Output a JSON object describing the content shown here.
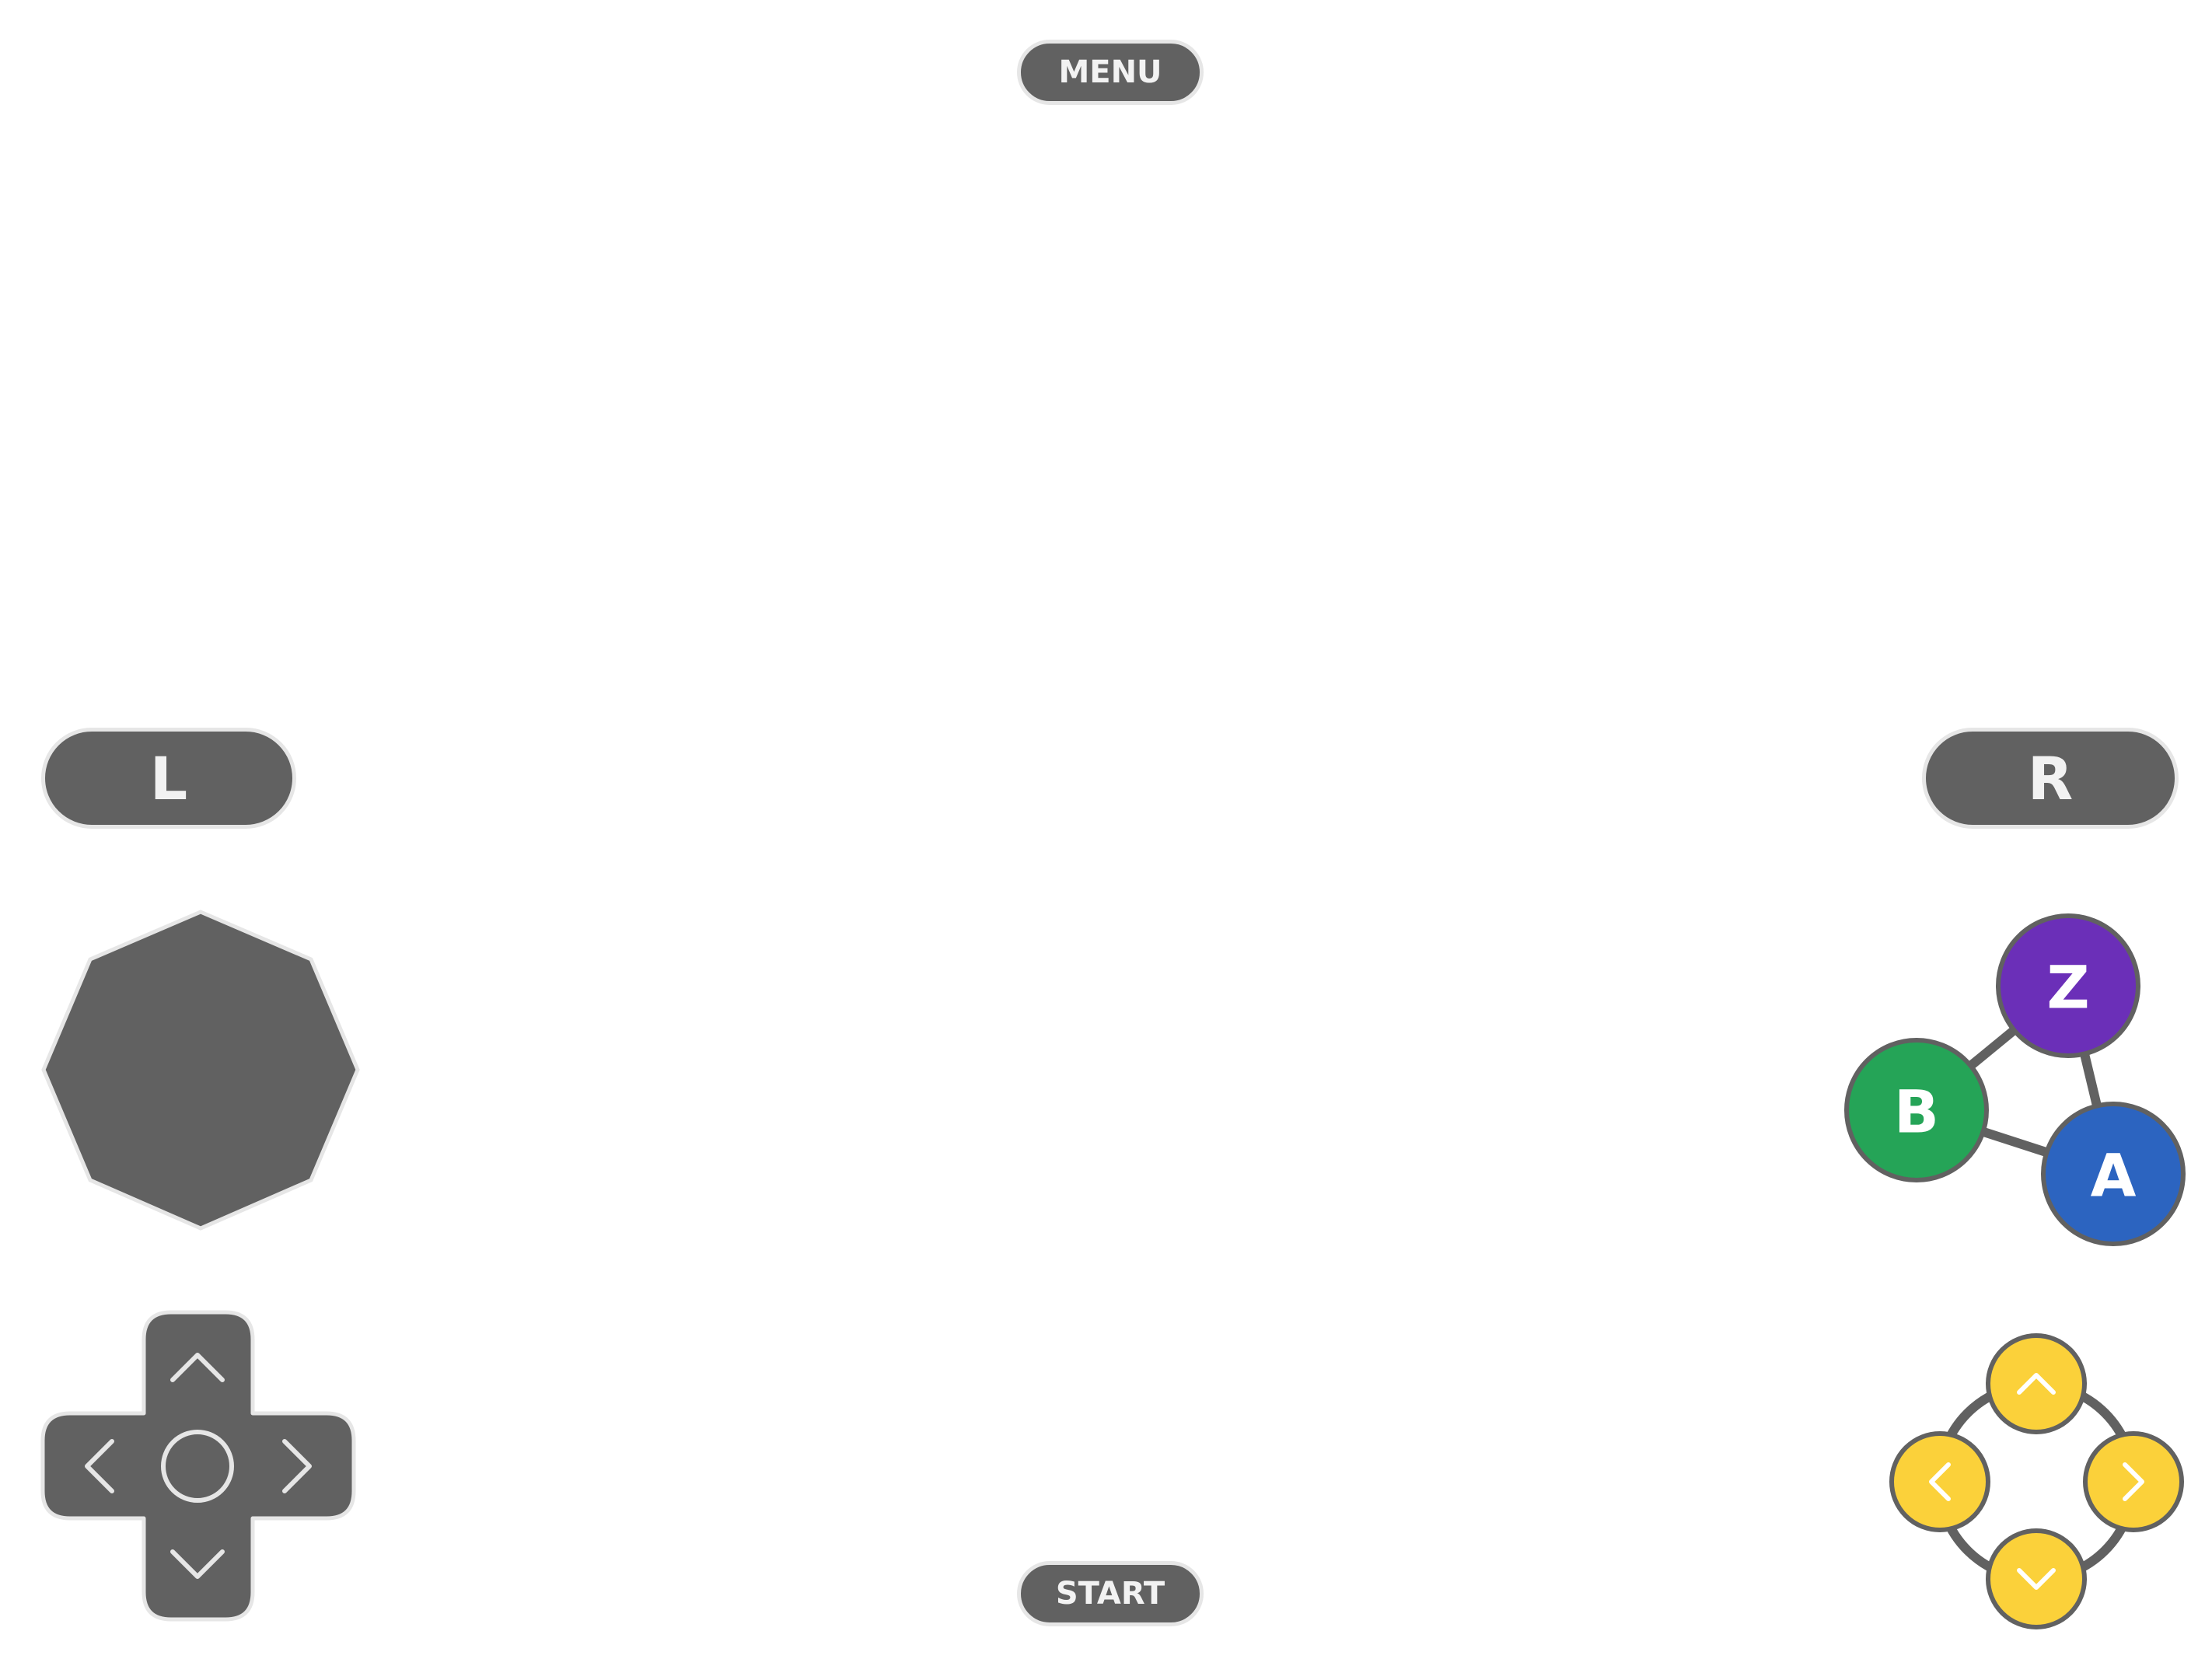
{
  "buttons": {
    "menu": "MENU",
    "start": "START",
    "l": "L",
    "r": "R",
    "z": "Z",
    "b": "B",
    "a": "A"
  },
  "icons": {
    "dpad": [
      "chevron-up-icon",
      "chevron-down-icon",
      "chevron-left-icon",
      "chevron-right-icon",
      "circle-icon"
    ],
    "c_buttons": [
      "chevron-up-icon",
      "chevron-down-icon",
      "chevron-left-icon",
      "chevron-right-icon"
    ]
  },
  "colors": {
    "control": "#616161",
    "outline": "#e6e6e6",
    "z": "#6b2fb8",
    "b": "#25a457",
    "a": "#2c64c0",
    "c": "#fbd13a"
  }
}
